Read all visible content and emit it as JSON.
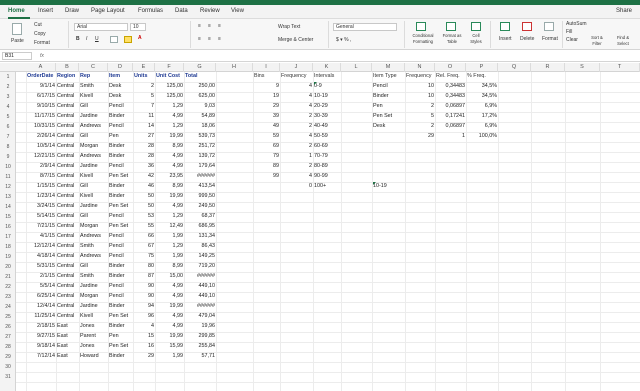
{
  "tabs": [
    "Home",
    "Insert",
    "Draw",
    "Page Layout",
    "Formulas",
    "Data",
    "Review",
    "View"
  ],
  "share_label": "Share",
  "ribbon": {
    "paste": "Paste",
    "cut": "Cut",
    "copy": "Copy",
    "format": "Format",
    "font_name": "Arial",
    "font_size": "10",
    "wrap_text": "Wrap Text",
    "merge_center": "Merge & Center",
    "number_format": "General",
    "conditional_formatting": "Conditional Formatting",
    "format_as_table": "Format as Table",
    "cell_styles": "Cell Styles",
    "insert": "Insert",
    "delete": "Delete",
    "format_cells": "Format",
    "autosum": "AutoSum",
    "fill": "Fill",
    "clear": "Clear",
    "sort_filter": "Sort & Filter",
    "find_select": "Find & Select"
  },
  "name_box": "B31",
  "fx_label": "fx",
  "columns": [
    "A",
    "B",
    "C",
    "D",
    "E",
    "F",
    "G",
    "H",
    "I",
    "J",
    "K",
    "L",
    "M",
    "N",
    "O",
    "P",
    "Q",
    "R",
    "S",
    "T"
  ],
  "headers": [
    "OrderDate",
    "Region",
    "Rep",
    "Item",
    "Units",
    "Unit Cost",
    "Total"
  ],
  "rows": [
    [
      "9/1/14",
      "Central",
      "Smith",
      "Desk",
      "2",
      "125,00",
      "250,00"
    ],
    [
      "6/17/15",
      "Central",
      "Kivell",
      "Desk",
      "5",
      "125,00",
      "625,00"
    ],
    [
      "9/10/15",
      "Central",
      "Gill",
      "Pencil",
      "7",
      "1,29",
      "9,03"
    ],
    [
      "11/17/15",
      "Central",
      "Jardine",
      "Binder",
      "11",
      "4,99",
      "54,89"
    ],
    [
      "10/31/15",
      "Central",
      "Andrews",
      "Pencil",
      "14",
      "1,29",
      "18,06"
    ],
    [
      "2/26/14",
      "Central",
      "Gill",
      "Pen",
      "27",
      "19,99",
      "539,73"
    ],
    [
      "10/5/14",
      "Central",
      "Morgan",
      "Binder",
      "28",
      "8,99",
      "251,72"
    ],
    [
      "12/21/15",
      "Central",
      "Andrews",
      "Binder",
      "28",
      "4,99",
      "139,72"
    ],
    [
      "2/9/14",
      "Central",
      "Jardine",
      "Pencil",
      "36",
      "4,99",
      "179,64"
    ],
    [
      "8/7/15",
      "Central",
      "Kivell",
      "Pen Set",
      "42",
      "23,95",
      "######"
    ],
    [
      "1/15/15",
      "Central",
      "Gill",
      "Binder",
      "46",
      "8,99",
      "413,54"
    ],
    [
      "1/23/14",
      "Central",
      "Kivell",
      "Binder",
      "50",
      "19,99",
      "999,50"
    ],
    [
      "3/24/15",
      "Central",
      "Jardine",
      "Pen Set",
      "50",
      "4,99",
      "249,50"
    ],
    [
      "5/14/15",
      "Central",
      "Gill",
      "Pencil",
      "53",
      "1,29",
      "68,37"
    ],
    [
      "7/21/15",
      "Central",
      "Morgan",
      "Pen Set",
      "55",
      "12,49",
      "686,95"
    ],
    [
      "4/1/15",
      "Central",
      "Andrews",
      "Pencil",
      "66",
      "1,99",
      "131,34"
    ],
    [
      "12/12/14",
      "Central",
      "Smith",
      "Pencil",
      "67",
      "1,29",
      "86,43"
    ],
    [
      "4/18/14",
      "Central",
      "Andrews",
      "Pencil",
      "75",
      "1,99",
      "149,25"
    ],
    [
      "5/31/15",
      "Central",
      "Gill",
      "Binder",
      "80",
      "8,99",
      "719,20"
    ],
    [
      "2/1/15",
      "Central",
      "Smith",
      "Binder",
      "87",
      "15,00",
      "######"
    ],
    [
      "5/5/14",
      "Central",
      "Jardine",
      "Pencil",
      "90",
      "4,99",
      "449,10"
    ],
    [
      "6/25/14",
      "Central",
      "Morgan",
      "Pencil",
      "90",
      "4,99",
      "449,10"
    ],
    [
      "12/4/14",
      "Central",
      "Jardine",
      "Binder",
      "94",
      "19,99",
      "######"
    ],
    [
      "11/25/14",
      "Central",
      "Kivell",
      "Pen Set",
      "96",
      "4,99",
      "479,04"
    ],
    [
      "2/18/15",
      "East",
      "Jones",
      "Binder",
      "4",
      "4,99",
      "19,96"
    ],
    [
      "9/27/15",
      "East",
      "Parent",
      "Pen",
      "15",
      "19,99",
      "299,85"
    ],
    [
      "9/18/14",
      "East",
      "Jones",
      "Pen Set",
      "16",
      "15,99",
      "255,84"
    ],
    [
      "7/12/14",
      "East",
      "Howard",
      "Binder",
      "29",
      "1,99",
      "57,71"
    ]
  ],
  "bins_header": "Bins",
  "frequency_header": "Frequency",
  "intervals_header": "Intervals",
  "bins": [
    "9",
    "19",
    "29",
    "39",
    "49",
    "59",
    "69",
    "79",
    "89",
    "99"
  ],
  "frequencies": [
    "4",
    "4",
    "4",
    "2",
    "2",
    "4",
    "2",
    "1",
    "2",
    "4",
    "0"
  ],
  "intervals": [
    "0-9",
    "10-19",
    "20-29",
    "30-39",
    "40-49",
    "50-59",
    "60-69",
    "70-79",
    "80-89",
    "90-99",
    "100+"
  ],
  "item_headers": [
    "Item Type",
    "Frequency",
    "Rel. Freq.",
    "% Freq."
  ],
  "items": [
    [
      "Pencil",
      "10",
      "0,34483",
      "34,5%"
    ],
    [
      "Binder",
      "10",
      "0,34483",
      "34,5%"
    ],
    [
      "Pen",
      "2",
      "0,06897",
      "6,9%"
    ],
    [
      "Pen Set",
      "5",
      "0,17241",
      "17,2%"
    ],
    [
      "Desk",
      "2",
      "0,06897",
      "6,9%"
    ]
  ],
  "item_totals": [
    "29",
    "1",
    "100,0%"
  ],
  "stray_label": "10-19"
}
